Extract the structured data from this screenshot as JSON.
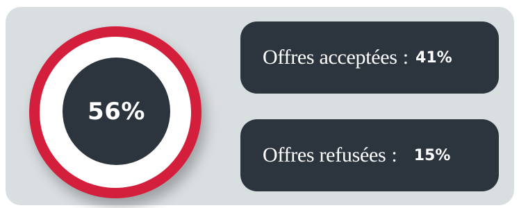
{
  "summary": {
    "percentage": "56%",
    "ring_color": "#d31f3b"
  },
  "stats": {
    "accepted": {
      "label": "Offres acceptées",
      "separator": ":",
      "value": "41%"
    },
    "refused": {
      "label": "Offres refusées",
      "separator": ":",
      "value": "15%"
    }
  },
  "colors": {
    "background_panel": "#d9dee1",
    "dark": "#2c343d",
    "accent": "#d31f3b",
    "text": "#ffffff"
  }
}
